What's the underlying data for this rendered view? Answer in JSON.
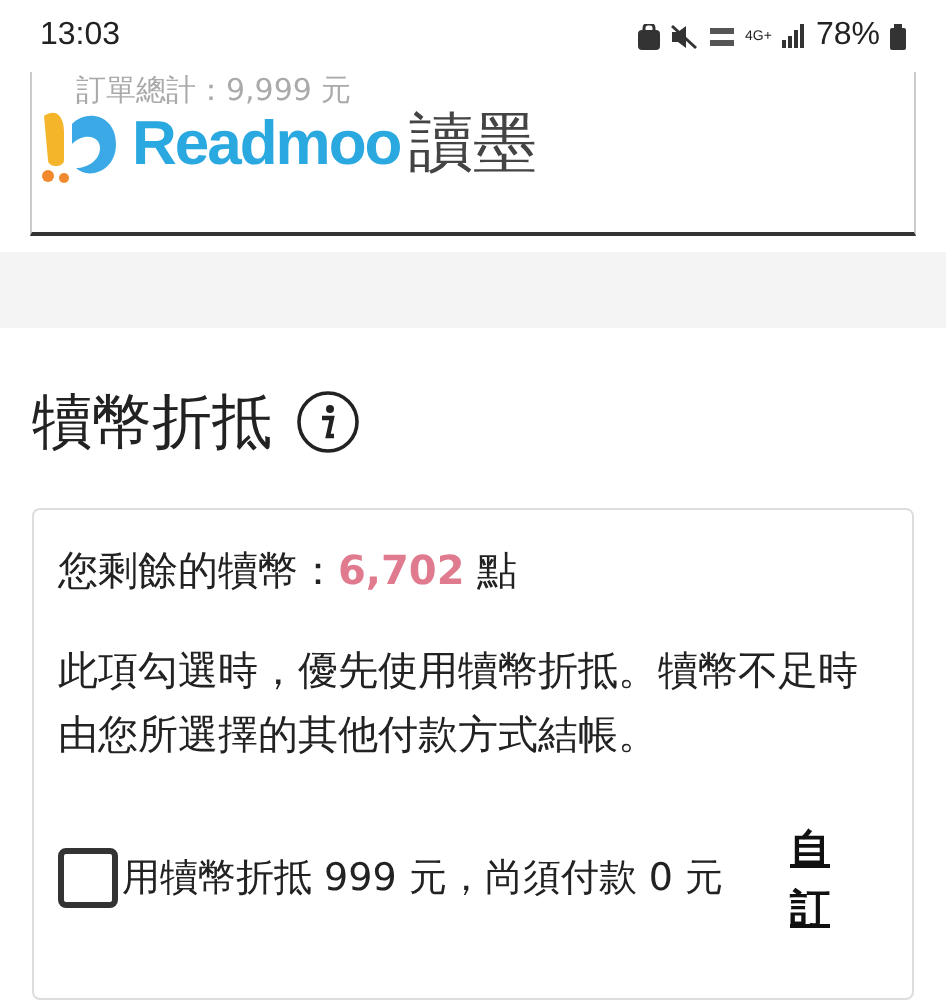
{
  "status_bar": {
    "time": "13:03",
    "battery": "78%",
    "network": "4G+"
  },
  "header": {
    "logo_text": "Readmoo",
    "logo_chinese": "讀墨",
    "faded_text": "訂單總計：9,999 元"
  },
  "section": {
    "title": "犢幣折抵",
    "balance_label": "您剩餘的犢幣：",
    "balance_value": "6,702",
    "balance_unit": "點",
    "description": "此項勾選時，優先使用犢幣折抵。犢幣不足時由您所選擇的其他付款方式結帳。",
    "option": {
      "label": "用犢幣折抵 999 元，尚須付款 0 元",
      "checked": false,
      "link": "自訂"
    }
  }
}
